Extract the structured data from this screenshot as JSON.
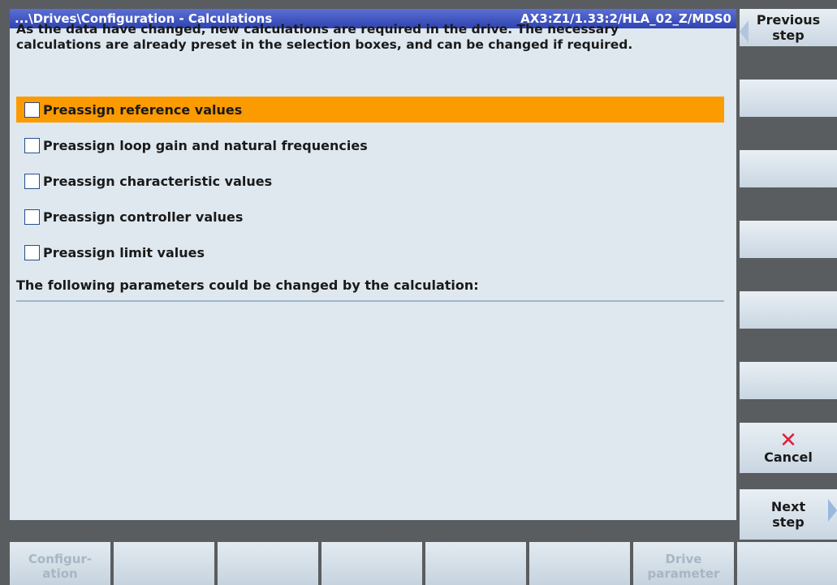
{
  "title": {
    "path": "...\\Drives\\Configuration - Calculations",
    "object": "AX3:Z1/1.33:2/HLA_02_Z/MDS0"
  },
  "description": {
    "line1": "As the data have changed, new calculations are required in the drive. The necessary",
    "line2": "calculations are already preset in the selection boxes, and can be changed if required."
  },
  "options": [
    {
      "label": "Preassign reference values",
      "checked": false,
      "selected": true
    },
    {
      "label": "Preassign loop gain and natural frequencies",
      "checked": false,
      "selected": false
    },
    {
      "label": "Preassign characteristic values",
      "checked": false,
      "selected": false
    },
    {
      "label": "Preassign controller values",
      "checked": false,
      "selected": false
    },
    {
      "label": "Preassign limit values",
      "checked": false,
      "selected": false
    }
  ],
  "params_label": "The following parameters could be changed by the calculation:",
  "vertical_softkeys": {
    "previous_line1": "Previous",
    "previous_line2": "step",
    "cancel": "Cancel",
    "next_line1": "Next",
    "next_line2": "step"
  },
  "horizontal_softkeys": {
    "configuration_line1": "Configur-",
    "configuration_line2": "ation",
    "drive_param_line1": "Drive",
    "drive_param_line2": "parameter"
  },
  "colors": {
    "selection": "#fb9b00",
    "title_bar": "#2f43b2",
    "cancel_icon": "#e0203a"
  },
  "icons": {
    "cancel": "close-icon",
    "previous": "arrow-left-icon",
    "next": "arrow-right-icon"
  }
}
